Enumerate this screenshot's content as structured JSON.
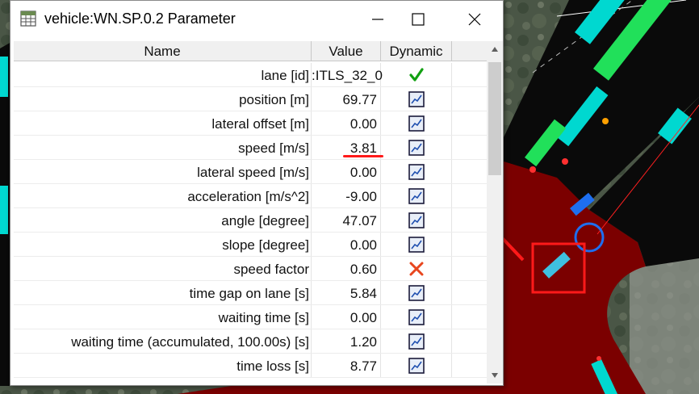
{
  "window": {
    "title": "vehicle:WN.SP.0.2 Parameter"
  },
  "table": {
    "headers": [
      "Name",
      "Value",
      "Dynamic"
    ],
    "rows": [
      {
        "name": "lane [id]",
        "value": ":ITLS_32_0",
        "dynamic": "checkmark-icon"
      },
      {
        "name": "position [m]",
        "value": "69.77",
        "dynamic": "plot-icon"
      },
      {
        "name": "lateral offset [m]",
        "value": "0.00",
        "dynamic": "plot-icon"
      },
      {
        "name": "speed [m/s]",
        "value": "3.81",
        "dynamic": "plot-icon"
      },
      {
        "name": "lateral speed [m/s]",
        "value": "0.00",
        "dynamic": "plot-icon"
      },
      {
        "name": "acceleration [m/s^2]",
        "value": "-9.00",
        "dynamic": "plot-icon"
      },
      {
        "name": "angle [degree]",
        "value": "47.07",
        "dynamic": "plot-icon"
      },
      {
        "name": "slope [degree]",
        "value": "0.00",
        "dynamic": "plot-icon"
      },
      {
        "name": "speed factor",
        "value": "0.60",
        "dynamic": "cross-icon"
      },
      {
        "name": "time gap on lane [s]",
        "value": "5.84",
        "dynamic": "plot-icon"
      },
      {
        "name": "waiting time [s]",
        "value": "0.00",
        "dynamic": "plot-icon"
      },
      {
        "name": "waiting time (accumulated, 100.00s) [s]",
        "value": "1.20",
        "dynamic": "plot-icon"
      },
      {
        "name": "time loss [s]",
        "value": "8.77",
        "dynamic": "plot-icon"
      }
    ]
  },
  "colors": {
    "annotation_red": "#ff1a1a",
    "annotation_blue": "#1e6ff0",
    "junction_red": "#7b0000",
    "road_black": "#0a0a0a"
  }
}
